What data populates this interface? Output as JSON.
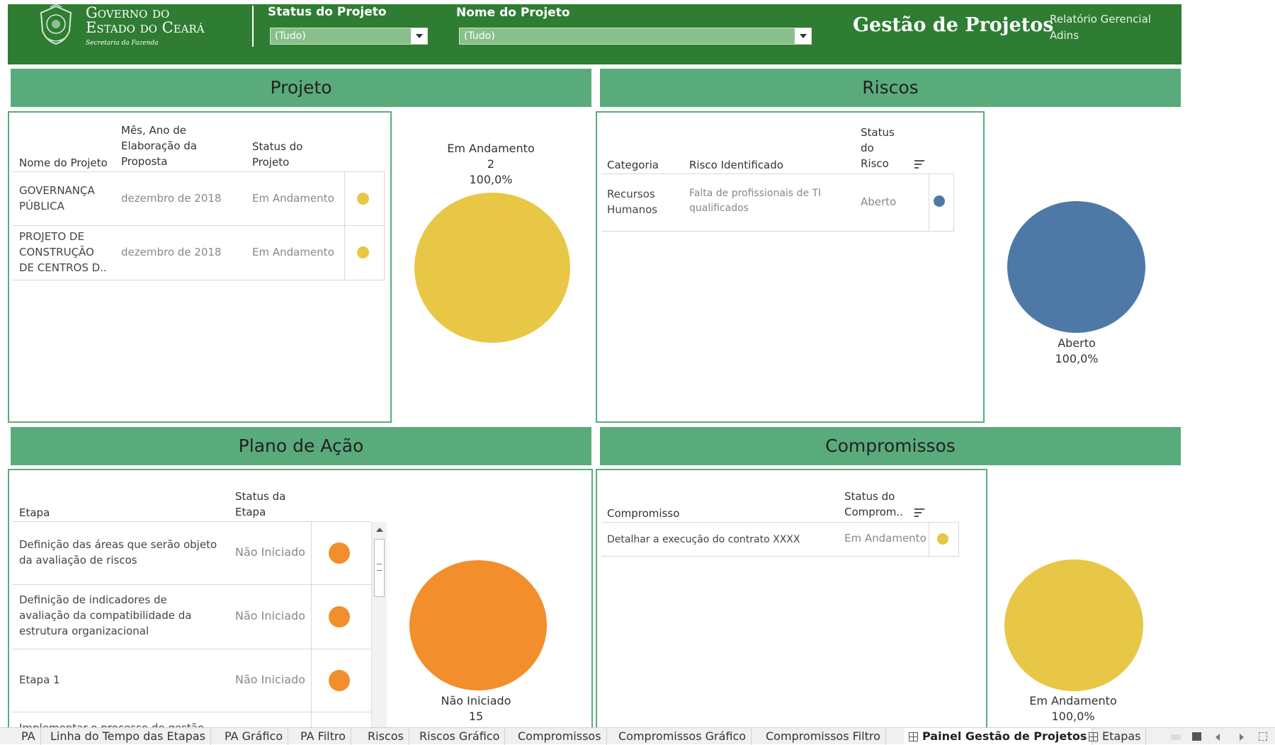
{
  "header": {
    "org_line1": "Governo do",
    "org_line2": "Estado do Ceará",
    "org_sub": "Secretaria da Fazenda",
    "filter_status_label": "Status do Projeto",
    "filter_status_value": "(Tudo)",
    "filter_name_label": "Nome do Projeto",
    "filter_name_value": "(Tudo)",
    "app_title": "Gestão de Projetos",
    "report_line1": "Relatório Gerencial",
    "report_line2": "Adins"
  },
  "projeto": {
    "title": "Projeto",
    "col_name_header": "Nome do Projeto",
    "col_date_header": [
      "Mês, Ano de",
      "Elaboração da",
      "Proposta"
    ],
    "col_status_header": [
      "Status do",
      "Projeto"
    ],
    "rows": [
      {
        "name": [
          "GOVERNANÇA",
          "PÚBLICA"
        ],
        "date": "dezembro de 2018",
        "status": "Em Andamento"
      },
      {
        "name": [
          "PROJETO DE",
          "CONSTRUÇÃO",
          "DE CENTROS D.."
        ],
        "date": "dezembro de 2018",
        "status": "Em Andamento"
      }
    ],
    "chart_label": "Em Andamento",
    "chart_count": "2",
    "chart_pct": "100,0%"
  },
  "riscos": {
    "title": "Riscos",
    "col_cat_header": "Categoria",
    "col_risk_header": "Risco Identificado",
    "col_status_header": [
      "Status",
      "do",
      "Risco"
    ],
    "rows": [
      {
        "category": [
          "Recursos",
          "Humanos"
        ],
        "risk": [
          "Falta de profissionais de TI",
          "qualificados"
        ],
        "status": "Aberto"
      }
    ],
    "chart_label": "Aberto",
    "chart_pct": "100,0%"
  },
  "plano": {
    "title": "Plano de Ação",
    "col_step_header": "Etapa",
    "col_status_header": [
      "Status da",
      "Etapa"
    ],
    "rows": [
      {
        "step": [
          "Definição das áreas que serão objeto",
          "da avaliação de riscos"
        ],
        "status": "Não Iniciado"
      },
      {
        "step": [
          "Definição de indicadores de",
          "avaliação da compatibilidade da",
          "estrutura organizacional"
        ],
        "status": "Não Iniciado"
      },
      {
        "step": [
          "Etapa 1"
        ],
        "status": "Não Iniciado"
      },
      {
        "step": [
          "Implementar o processo de gestão"
        ],
        "status": ""
      }
    ],
    "chart_label": "Não Iniciado",
    "chart_count": "15"
  },
  "compromissos": {
    "title": "Compromissos",
    "col_comp_header": "Compromisso",
    "col_status_header": [
      "Status do",
      "Comprom.."
    ],
    "rows": [
      {
        "commitment": "Detalhar a execução do contrato XXXX",
        "status": "Em Andamento"
      }
    ],
    "chart_label": "Em Andamento",
    "chart_pct": "100,0%"
  },
  "colors": {
    "header_green": "#2e7d32",
    "section_green": "#5aab7c",
    "yellow": "#e8c747",
    "blue": "#4e79a7",
    "orange": "#f28e2b"
  },
  "tabs": [
    "PA",
    "Linha do Tempo das Etapas",
    "PA Gráfico",
    "PA  Filtro",
    "Riscos",
    "Riscos Gráfico",
    "Compromissos",
    "Compromissos Gráfico",
    "Compromissos  Filtro",
    "Painel Gestão de Projetos",
    "Etapas"
  ],
  "active_tab": "Painel Gestão de Projetos"
}
